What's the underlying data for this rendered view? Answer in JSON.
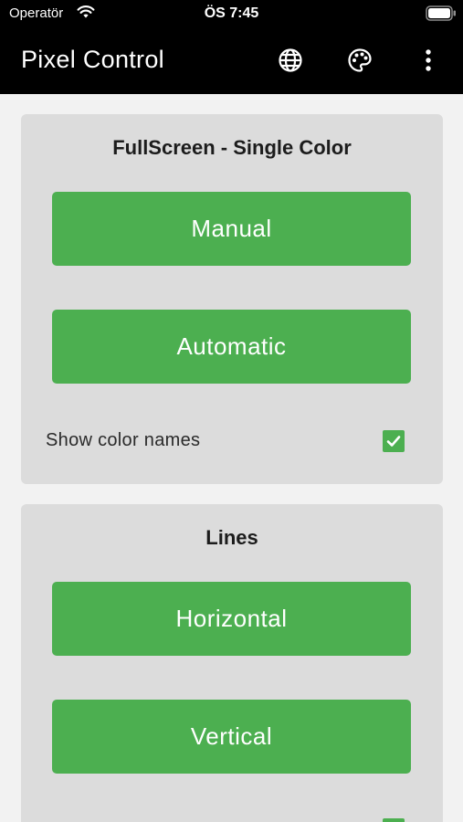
{
  "status_bar": {
    "carrier": "Operatör",
    "time": "ÖS 7:45"
  },
  "app_bar": {
    "title": "Pixel Control",
    "actions": [
      "language-icon",
      "palette-icon",
      "more-vert-icon"
    ]
  },
  "colors": {
    "accent": "#4caf50",
    "card_bg": "#dcdcdc",
    "app_bar_bg": "#000000",
    "page_bg": "#f2f2f2"
  },
  "sections": [
    {
      "title": "FullScreen - Single Color",
      "buttons": [
        "Manual",
        "Automatic"
      ],
      "option_label": "Show color names",
      "option_checked": true
    },
    {
      "title": "Lines",
      "buttons": [
        "Horizontal",
        "Vertical"
      ],
      "option_checked": true
    }
  ]
}
